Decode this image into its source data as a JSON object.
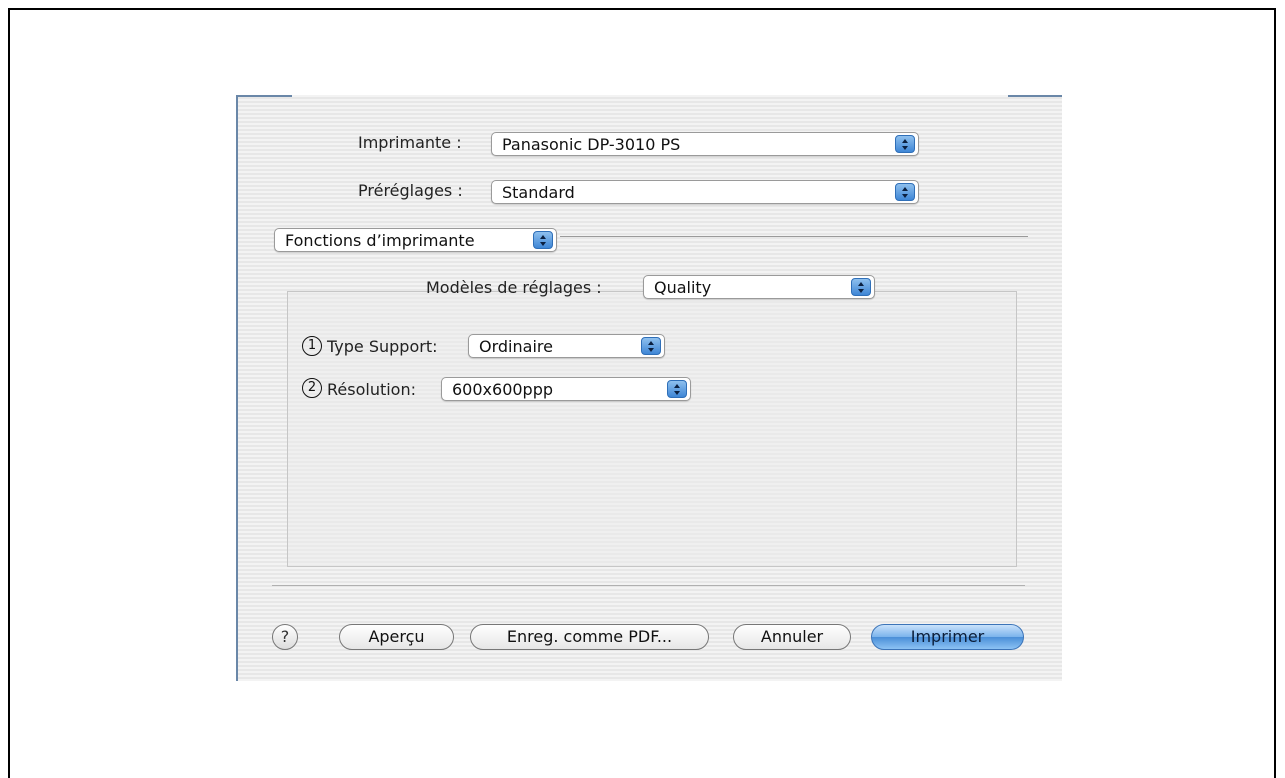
{
  "printer": {
    "label": "Imprimante :",
    "value": "Panasonic DP-3010 PS"
  },
  "presets": {
    "label": "Préréglages :",
    "value": "Standard"
  },
  "panel_selector": {
    "value": "Fonctions d’imprimante"
  },
  "settings_model": {
    "label": "Modèles de réglages :",
    "value": "Quality"
  },
  "media_type": {
    "marker": "1",
    "label": "Type Support:",
    "value": "Ordinaire"
  },
  "resolution": {
    "marker": "2",
    "label": "Résolution:",
    "value": "600x600ppp"
  },
  "buttons": {
    "help": "?",
    "preview": "Aperçu",
    "save_pdf": "Enreg. comme PDF...",
    "cancel": "Annuler",
    "print": "Imprimer"
  },
  "colors": {
    "accent": "#4a8fd8",
    "window_edge": "#6a87a8"
  },
  "icons": {
    "popup_arrows": "up-down-arrows-icon",
    "help": "question-mark-icon"
  }
}
